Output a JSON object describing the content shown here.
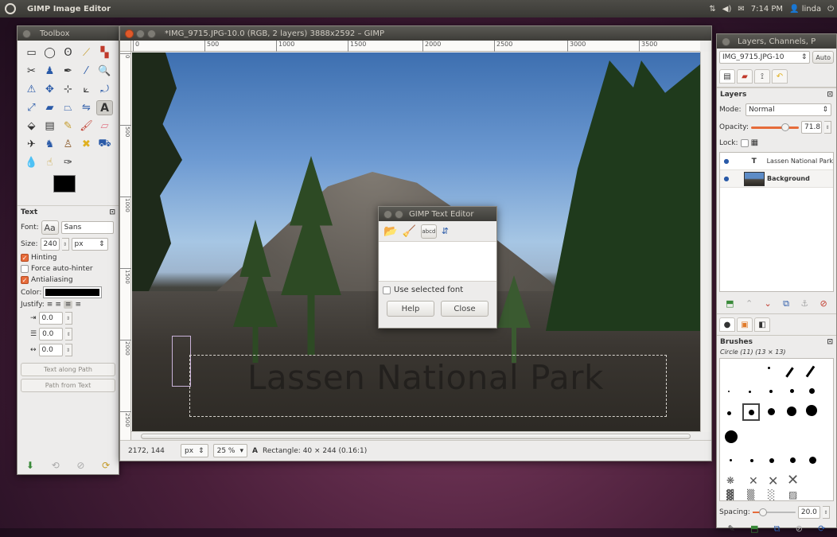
{
  "top_panel": {
    "app_title": "GIMP Image Editor",
    "tray": {
      "network": "⇅",
      "volume": "◀)",
      "mail": "✉",
      "time": "7:14 PM",
      "user": "linda",
      "power": "⏻"
    }
  },
  "toolbox": {
    "title": "Toolbox",
    "section_title": "Text",
    "font_label": "Font:",
    "font_preview": "Aa",
    "font_value": "Sans",
    "size_label": "Size:",
    "size_value": "240",
    "size_unit": "px",
    "hinting_label": "Hinting",
    "hinting_checked": true,
    "force_autohinter_label": "Force auto-hinter",
    "force_autohinter_checked": false,
    "antialiasing_label": "Antialiasing",
    "antialiasing_checked": true,
    "color_label": "Color:",
    "color_value": "#000000",
    "justify_label": "Justify:",
    "indent_value": "0.0",
    "line_spacing_value": "0.0",
    "letter_spacing_value": "0.0",
    "text_along_path_label": "Text along Path",
    "path_from_text_label": "Path from Text"
  },
  "image_window": {
    "title": "*IMG_9715.JPG-10.0 (RGB, 2 layers) 3888x2592 – GIMP",
    "ruler_h": [
      "0",
      "500",
      "1000",
      "1500",
      "2000",
      "2500",
      "3000",
      "3500"
    ],
    "ruler_v": [
      "0",
      "500",
      "1000",
      "1500",
      "2000",
      "2500"
    ],
    "canvas_text": "Lassen National Park",
    "status": {
      "coordinates": "2172, 144",
      "unit": "px",
      "zoom": "25 %",
      "message": "Rectangle: 40 × 244 (0.16:1)"
    }
  },
  "text_editor": {
    "title": "GIMP Text Editor",
    "use_selected_font_label": "Use selected font",
    "help_label": "Help",
    "close_label": "Close"
  },
  "dock": {
    "title": "Layers, Channels, P",
    "image_selector": "IMG_9715.JPG-10",
    "auto_label": "Auto",
    "layers_title": "Layers",
    "mode_label": "Mode:",
    "mode_value": "Normal",
    "opacity_label": "Opacity:",
    "opacity_value": "71.8",
    "lock_label": "Lock:",
    "layers": [
      {
        "name": "Lassen National Park",
        "type": "text",
        "visible": true
      },
      {
        "name": "Background",
        "type": "image",
        "visible": true
      }
    ],
    "brushes_title": "Brushes",
    "brush_name": "Circle (11) (13 × 13)",
    "spacing_label": "Spacing:",
    "spacing_value": "20.0"
  },
  "colors": {
    "accent_orange": "#e66b3a",
    "panel_dark": "#3a3935",
    "desktop_purple": "#4a1f3a"
  }
}
